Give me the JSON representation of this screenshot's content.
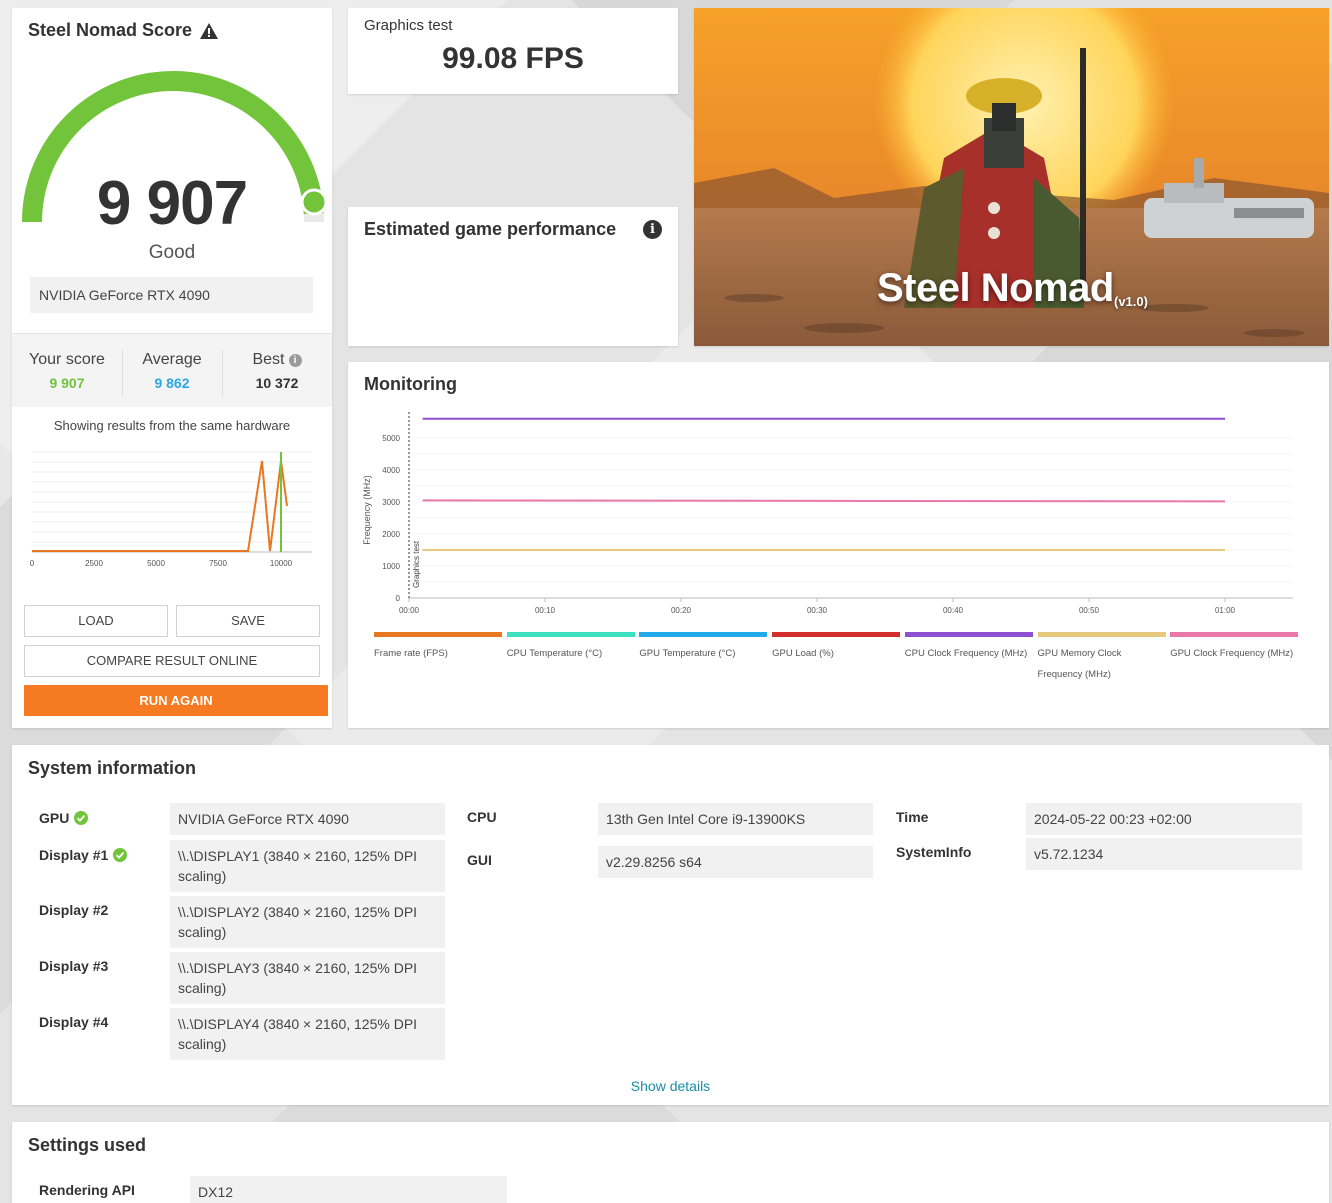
{
  "score": {
    "title": "Steel Nomad Score",
    "value": "9 907",
    "rating": "Good",
    "hardware": "NVIDIA GeForce RTX 4090",
    "gauge_fraction": 0.98,
    "comparison": {
      "your_label": "Your score",
      "your_value": "9 907",
      "avg_label": "Average",
      "avg_value": "9 862",
      "best_label": "Best",
      "best_value": "10 372"
    },
    "same_hw_text": "Showing results from the same hardware",
    "dist_ticks": [
      "0",
      "2500",
      "5000",
      "7500",
      "10000"
    ],
    "buttons": {
      "load": "LOAD",
      "save": "SAVE",
      "compare": "COMPARE RESULT ONLINE",
      "run": "RUN AGAIN"
    }
  },
  "graphics_test": {
    "label": "Graphics test",
    "value": "99.08 FPS"
  },
  "estimated": {
    "title": "Estimated game performance"
  },
  "hero": {
    "title": "Steel Nomad",
    "version": "(v1.0)"
  },
  "monitoring": {
    "title": "Monitoring",
    "legend": [
      {
        "label": "Frame rate (FPS)",
        "color": "#e87722"
      },
      {
        "label": "CPU Temperature (°C)",
        "color": "#3de0c0"
      },
      {
        "label": "GPU Temperature (°C)",
        "color": "#22aaea"
      },
      {
        "label": "GPU Load (%)",
        "color": "#d32f2f"
      },
      {
        "label": "CPU Clock Frequency (MHz)",
        "color": "#8e4fd0"
      },
      {
        "label": "GPU Memory Clock Frequency (MHz)",
        "color": "#e8c87c"
      },
      {
        "label": "GPU Clock Frequency (MHz)",
        "color": "#e879a8"
      }
    ]
  },
  "chart_data": {
    "type": "line",
    "title": "",
    "ylabel": "Frequency (MHz)",
    "annotation": "Graphics test",
    "ylim": [
      0,
      5500
    ],
    "yticks": [
      0,
      1000,
      2000,
      3000,
      4000,
      5000
    ],
    "xticks": [
      "00:00",
      "00:10",
      "00:20",
      "00:30",
      "00:40",
      "00:50",
      "01:00"
    ],
    "xlim_seconds": [
      0,
      65
    ],
    "series": [
      {
        "name": "CPU Clock Frequency (MHz)",
        "color": "#8e4fd0",
        "x": [
          1,
          60
        ],
        "values": [
          5600,
          5600
        ]
      },
      {
        "name": "GPU Clock Frequency (MHz)",
        "color": "#e879a8",
        "x": [
          1,
          60
        ],
        "values": [
          3050,
          3020
        ]
      },
      {
        "name": "GPU Memory Clock Frequency (MHz)",
        "color": "#e8c87c",
        "x": [
          1,
          60
        ],
        "values": [
          1500,
          1500
        ]
      }
    ]
  },
  "system": {
    "title": "System information",
    "gpu_label": "GPU",
    "gpu_value": "NVIDIA GeForce RTX 4090",
    "d1_label": "Display #1",
    "d1_value": "\\\\.\\DISPLAY1 (3840 × 2160, 125% DPI scaling)",
    "d2_label": "Display #2",
    "d2_value": "\\\\.\\DISPLAY2 (3840 × 2160, 125% DPI scaling)",
    "d3_label": "Display #3",
    "d3_value": "\\\\.\\DISPLAY3 (3840 × 2160, 125% DPI scaling)",
    "d4_label": "Display #4",
    "d4_value": "\\\\.\\DISPLAY4 (3840 × 2160, 125% DPI scaling)",
    "cpu_label": "CPU",
    "cpu_value": "13th Gen Intel Core i9-13900KS",
    "gui_label": "GUI",
    "gui_value": "v2.29.8256 s64",
    "time_label": "Time",
    "time_value": "2024-05-22 00:23 +02:00",
    "sysinfo_label": "SystemInfo",
    "sysinfo_value": "v5.72.1234",
    "show_details": "Show details"
  },
  "settings": {
    "title": "Settings used",
    "api_label": "Rendering API",
    "api_value": "DX12"
  },
  "colors": {
    "accent_green": "#72c43a",
    "accent_orange": "#f67a21",
    "average_blue": "#2aa8e0",
    "link": "#1b8da7"
  }
}
